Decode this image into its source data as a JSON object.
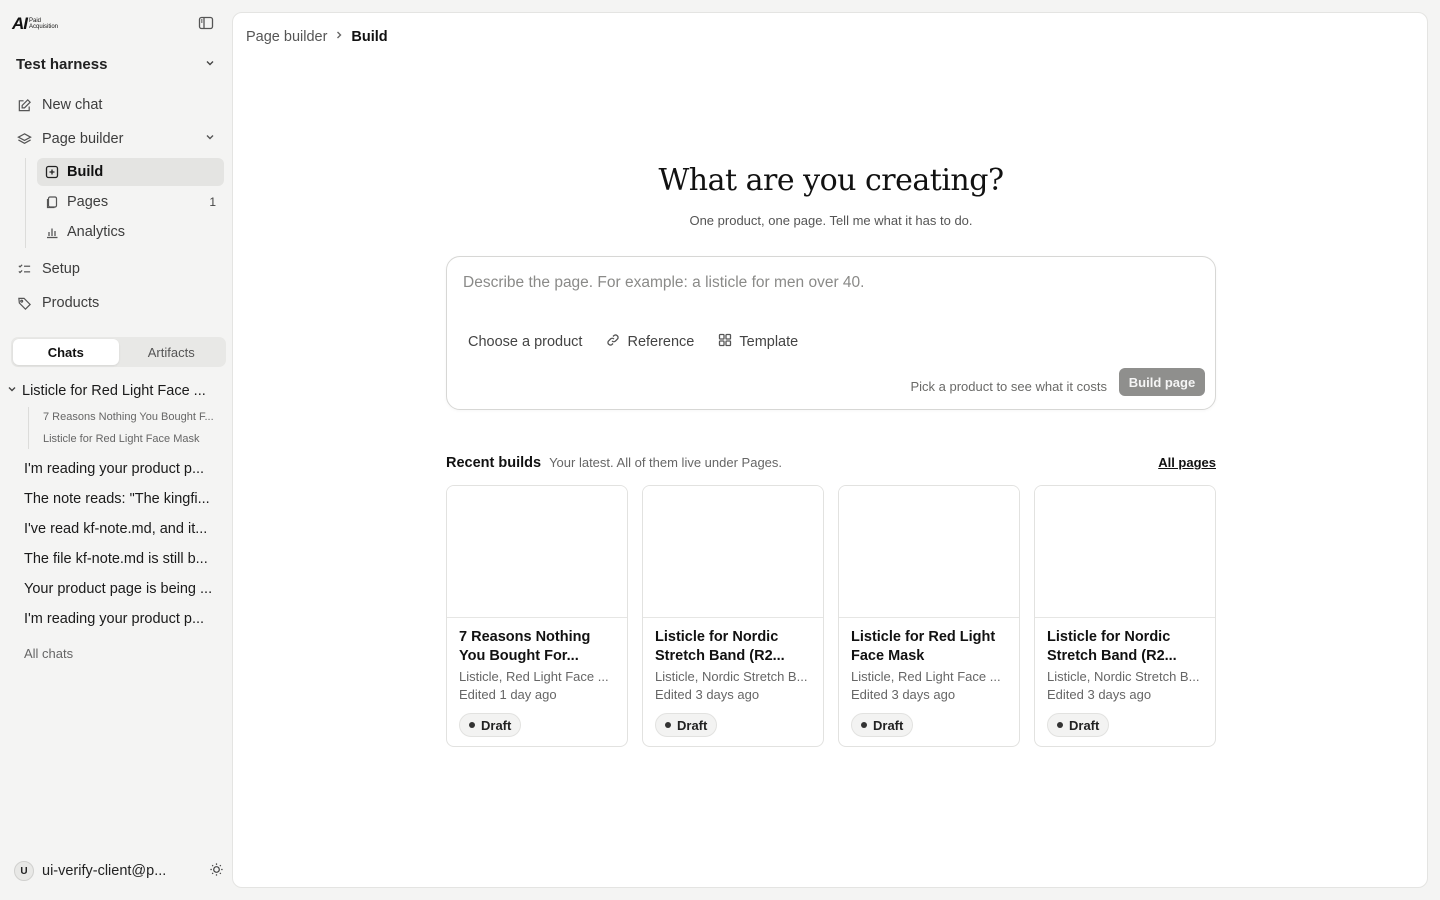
{
  "sidebar": {
    "logo_mark": "AI",
    "logo_text_line1": "Paid",
    "logo_text_line2": "Acquisition",
    "workspace": "Test harness",
    "nav": {
      "new_chat": "New chat",
      "page_builder": "Page builder",
      "build": "Build",
      "pages": "Pages",
      "pages_count": "1",
      "analytics": "Analytics",
      "setup": "Setup",
      "products": "Products"
    },
    "tabs": {
      "chats": "Chats",
      "artifacts": "Artifacts"
    },
    "chat_group": {
      "title": "Listicle for Red Light Face ...",
      "children": [
        "7 Reasons Nothing You Bought F...",
        "Listicle for Red Light Face Mask"
      ]
    },
    "chats": [
      "I'm reading your product p...",
      "The note reads: \"The kingfi...",
      "I've read kf-note.md, and it...",
      "The file kf-note.md is still b...",
      "Your product page is being ...",
      "I'm reading your product p..."
    ],
    "all_chats": "All chats",
    "user": {
      "initial": "U",
      "email": "ui-verify-client@p..."
    }
  },
  "breadcrumb": {
    "parent": "Page builder",
    "current": "Build"
  },
  "hero": {
    "title": "What are you creating?",
    "subtitle": "One product, one page. Tell me what it has to do."
  },
  "composer": {
    "placeholder": "Describe the page. For example: a listicle for men over 40.",
    "value": "",
    "choose_product": "Choose a product",
    "reference": "Reference",
    "template": "Template",
    "cost_hint": "Pick a product to see what it costs",
    "build_button": "Build page"
  },
  "recent": {
    "title": "Recent builds",
    "subtitle": "Your latest. All of them live under Pages.",
    "all_pages": "All pages",
    "cards": [
      {
        "title": "7 Reasons Nothing You Bought For...",
        "meta": "Listicle, Red Light Face ...",
        "edited": "Edited 1 day ago",
        "status": "Draft"
      },
      {
        "title": "Listicle for Nordic Stretch Band (R2...",
        "meta": "Listicle, Nordic Stretch B...",
        "edited": "Edited 3 days ago",
        "status": "Draft"
      },
      {
        "title": "Listicle for Red Light Face Mask",
        "meta": "Listicle, Red Light Face ...",
        "edited": "Edited 3 days ago",
        "status": "Draft"
      },
      {
        "title": "Listicle for Nordic Stretch Band (R2...",
        "meta": "Listicle, Nordic Stretch B...",
        "edited": "Edited 3 days ago",
        "status": "Draft"
      }
    ]
  }
}
